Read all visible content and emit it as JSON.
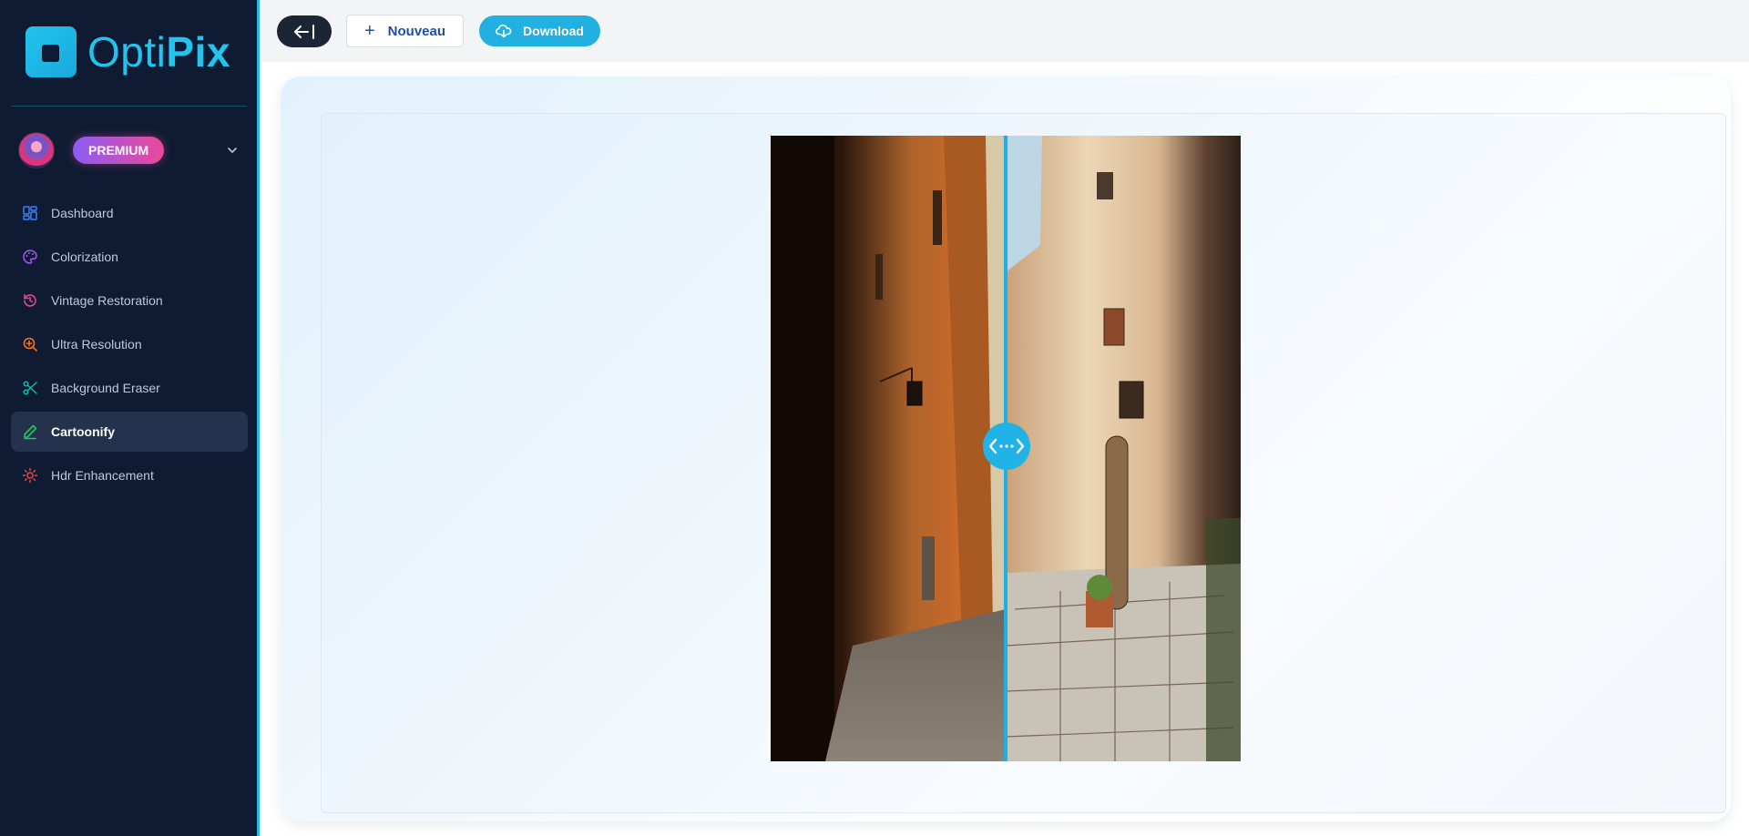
{
  "app": {
    "logo_light": "Opti",
    "logo_bold": "Pix",
    "accent": "#22c4ee"
  },
  "profile": {
    "badge": "PREMIUM"
  },
  "sidebar": {
    "items": [
      {
        "label": "Dashboard",
        "icon": "grid-icon",
        "color": "#3b82f6"
      },
      {
        "label": "Colorization",
        "icon": "palette-icon",
        "color": "#a855f7"
      },
      {
        "label": "Vintage Restoration",
        "icon": "history-icon",
        "color": "#ec4899"
      },
      {
        "label": "Ultra Resolution",
        "icon": "zoom-in-icon",
        "color": "#f97316"
      },
      {
        "label": "Background Eraser",
        "icon": "scissors-icon",
        "color": "#14b8a6"
      },
      {
        "label": "Cartoonify",
        "icon": "pen-icon",
        "color": "#22c55e",
        "active": true
      },
      {
        "label": "Hdr Enhancement",
        "icon": "sun-icon",
        "color": "#ef4444"
      }
    ]
  },
  "toolbar": {
    "new_label": "Nouveau",
    "download_label": "Download"
  }
}
